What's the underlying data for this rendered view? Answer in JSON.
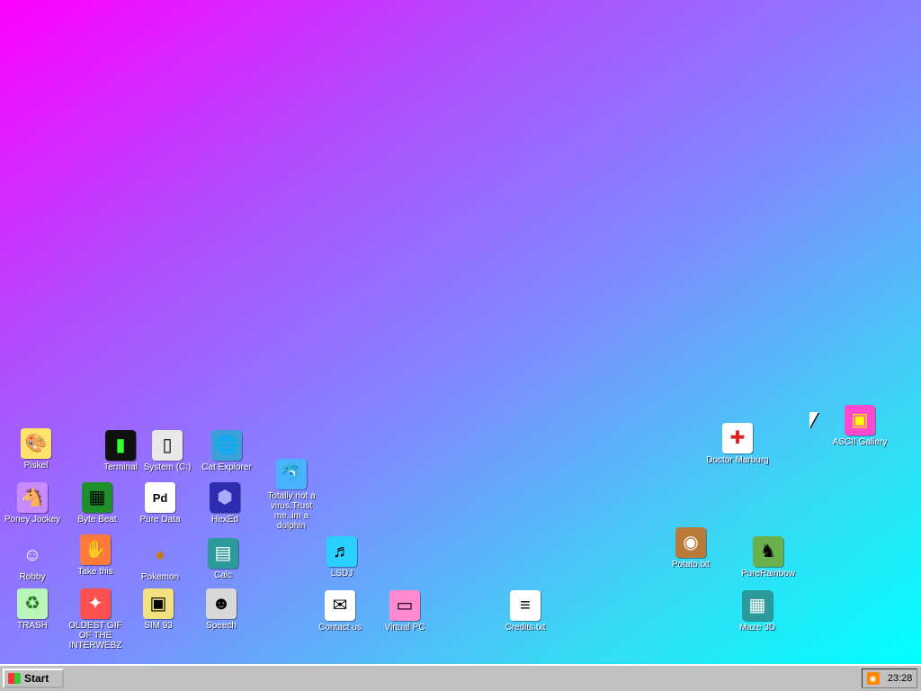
{
  "taskbar": {
    "start_label": "Start",
    "clock": "23:28",
    "tray_icon": "rss-icon"
  },
  "icons": [
    {
      "id": "piskel",
      "label": "Piskel",
      "glyph": "🎨",
      "color": "#ffe26b"
    },
    {
      "id": "terminal",
      "label": "Terminal",
      "glyph": "▮",
      "color": "#111111"
    },
    {
      "id": "system-c",
      "label": "System (C:)",
      "glyph": "▯",
      "color": "#e8e8e8"
    },
    {
      "id": "cat-explorer",
      "label": "Cat Explorer",
      "glyph": "🌐",
      "color": "#3aa0d8"
    },
    {
      "id": "poney-jockey",
      "label": "Poney Jockey",
      "glyph": "🐴",
      "color": "#c88bff"
    },
    {
      "id": "byte-beat",
      "label": "Byte Beat",
      "glyph": "▦",
      "color": "#1e8f2a"
    },
    {
      "id": "pure-data",
      "label": "Pure Data",
      "glyph": "Pd",
      "color": "#ffffff"
    },
    {
      "id": "hexed",
      "label": "HexEd",
      "glyph": "⬢",
      "color": "#2c2cb0"
    },
    {
      "id": "dolphin",
      "label": "Totally not a virus.Trust me..im a dolphin",
      "glyph": "🐬",
      "color": "#4ab3ff"
    },
    {
      "id": "robby",
      "label": "Robby",
      "glyph": "☺",
      "color": "#ffffff"
    },
    {
      "id": "take-this",
      "label": "Take this",
      "glyph": "✋",
      "color": "#ff7a3a"
    },
    {
      "id": "pokemon",
      "label": "Pokemon",
      "glyph": "●",
      "color": "#c07a2a"
    },
    {
      "id": "calc",
      "label": "Calc",
      "glyph": "▤",
      "color": "#2a9a9a"
    },
    {
      "id": "lsdj",
      "label": "LSDJ",
      "glyph": "♬",
      "color": "#2ad0ff"
    },
    {
      "id": "trash",
      "label": "TRASH",
      "glyph": "♻",
      "color": "#b9f5b9"
    },
    {
      "id": "oldest-gif",
      "label": "OLDEST GIF OF THE INTERWEBZ",
      "glyph": "✦",
      "color": "#ff5050"
    },
    {
      "id": "sim93",
      "label": "SIM 93",
      "glyph": "▣",
      "color": "#f0e080"
    },
    {
      "id": "speech",
      "label": "Speech",
      "glyph": "☻",
      "color": "#d8d8d8"
    },
    {
      "id": "contact-us",
      "label": "Contact us",
      "glyph": "✉",
      "color": "#ffffff"
    },
    {
      "id": "virtual-pc",
      "label": "Virtual PC",
      "glyph": "▭",
      "color": "#ff8ad0"
    },
    {
      "id": "credits",
      "label": "Credits.txt",
      "glyph": "≡",
      "color": "#ffffff"
    },
    {
      "id": "potato",
      "label": "Potato.txt",
      "glyph": "◉",
      "color": "#b97a3a"
    },
    {
      "id": "maze3d",
      "label": "Maze 3D",
      "glyph": "▦",
      "color": "#2a9a9a"
    },
    {
      "id": "purerainbow",
      "label": "PureRainbow",
      "glyph": "♞",
      "color": "#6ab04c"
    },
    {
      "id": "doctor-marburg",
      "label": "Doctor Marburg",
      "glyph": "✚",
      "color": "#ffffff"
    },
    {
      "id": "ascii-gallery",
      "label": "ASCII Gallery",
      "glyph": "▣",
      "color": "#ff4ad0"
    }
  ]
}
